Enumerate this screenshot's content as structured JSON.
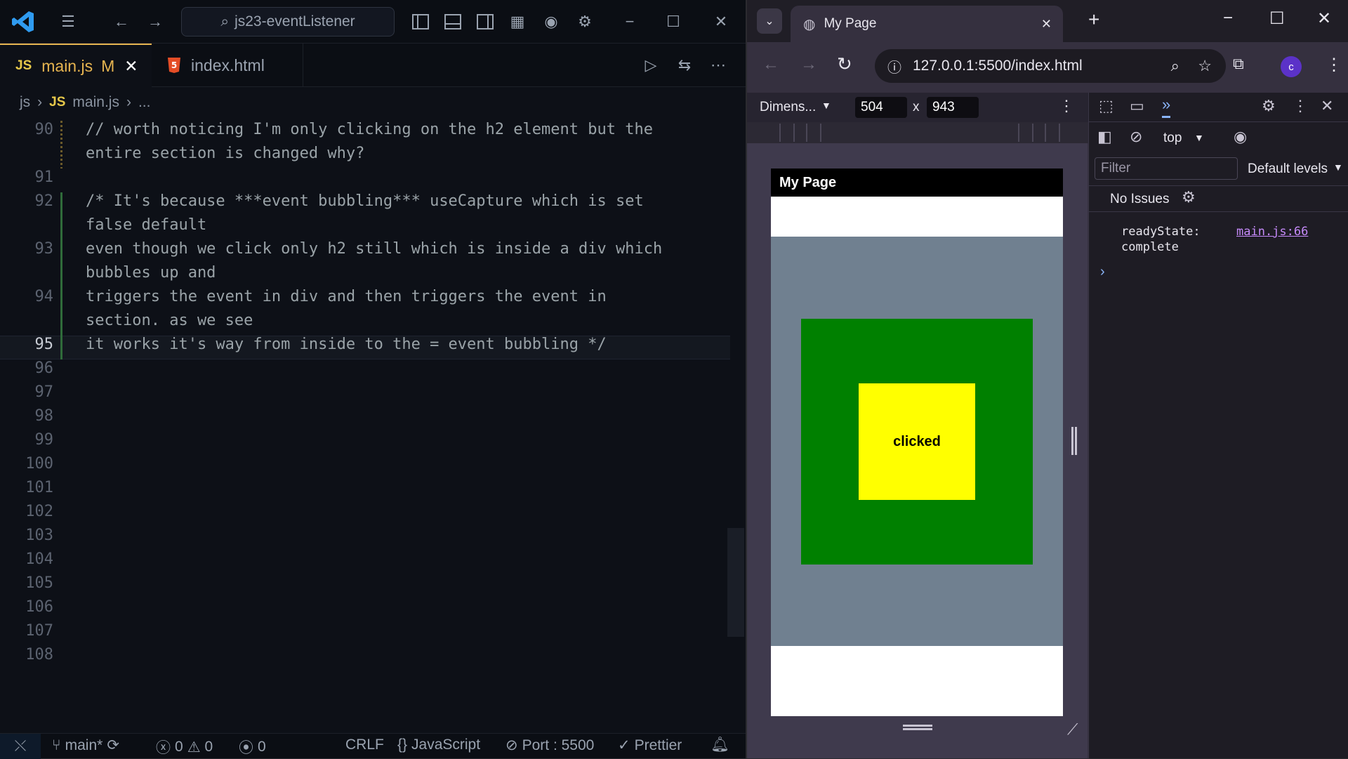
{
  "vscode": {
    "search": "js23-eventListener",
    "tabs": [
      {
        "label": "main.js",
        "badge": "M",
        "icon": "JS"
      },
      {
        "label": "index.html",
        "icon": "html5"
      }
    ],
    "breadcrumb": {
      "folder": "js",
      "file_icon": "JS",
      "file": "main.js",
      "more": "..."
    },
    "lines": [
      {
        "n": "90",
        "text": "// worth noticing I'm only clicking on the h2 element but the"
      },
      {
        "n": "",
        "text": "entire section is changed why?"
      },
      {
        "n": "91",
        "text": ""
      },
      {
        "n": "92",
        "text": "/* It's because ***event bubbling*** useCapture which is set"
      },
      {
        "n": "",
        "text": "false default"
      },
      {
        "n": "93",
        "text": "even though we click only h2 still which is inside a div which"
      },
      {
        "n": "",
        "text": "bubbles up and"
      },
      {
        "n": "94",
        "text": "triggers the event in div and then triggers the event in"
      },
      {
        "n": "",
        "text": "section. as we see"
      },
      {
        "n": "95",
        "text": "it works it's way from inside to the = event bubbling */"
      },
      {
        "n": "96",
        "text": ""
      },
      {
        "n": "97",
        "text": ""
      },
      {
        "n": "98",
        "text": ""
      },
      {
        "n": "99",
        "text": ""
      },
      {
        "n": "100",
        "text": ""
      },
      {
        "n": "101",
        "text": ""
      },
      {
        "n": "102",
        "text": ""
      },
      {
        "n": "103",
        "text": ""
      },
      {
        "n": "104",
        "text": ""
      },
      {
        "n": "105",
        "text": ""
      },
      {
        "n": "106",
        "text": ""
      },
      {
        "n": "107",
        "text": ""
      },
      {
        "n": "108",
        "text": ""
      }
    ],
    "status": {
      "branch": "main*",
      "errors": "0",
      "warnings": "0",
      "ports": "0",
      "eol": "CRLF",
      "language": "JavaScript",
      "port": "Port : 5500",
      "formatter": "Prettier"
    }
  },
  "chrome": {
    "tab_title": "My Page",
    "url": "127.0.0.1:5500/index.html",
    "profile": "c",
    "device": {
      "preset": "Dimens...",
      "width": "504",
      "height": "943",
      "x": "x"
    },
    "page": {
      "header": "My Page",
      "box_text": "clicked"
    },
    "colors": {
      "section": "#708090",
      "div": "#008000",
      "h2": "#ffff00"
    },
    "devtools": {
      "context": "top",
      "filter_placeholder": "Filter",
      "levels": "Default levels",
      "issues": "No Issues",
      "log": {
        "key": "readyState:",
        "value": "complete",
        "source": "main.js:66"
      }
    }
  }
}
